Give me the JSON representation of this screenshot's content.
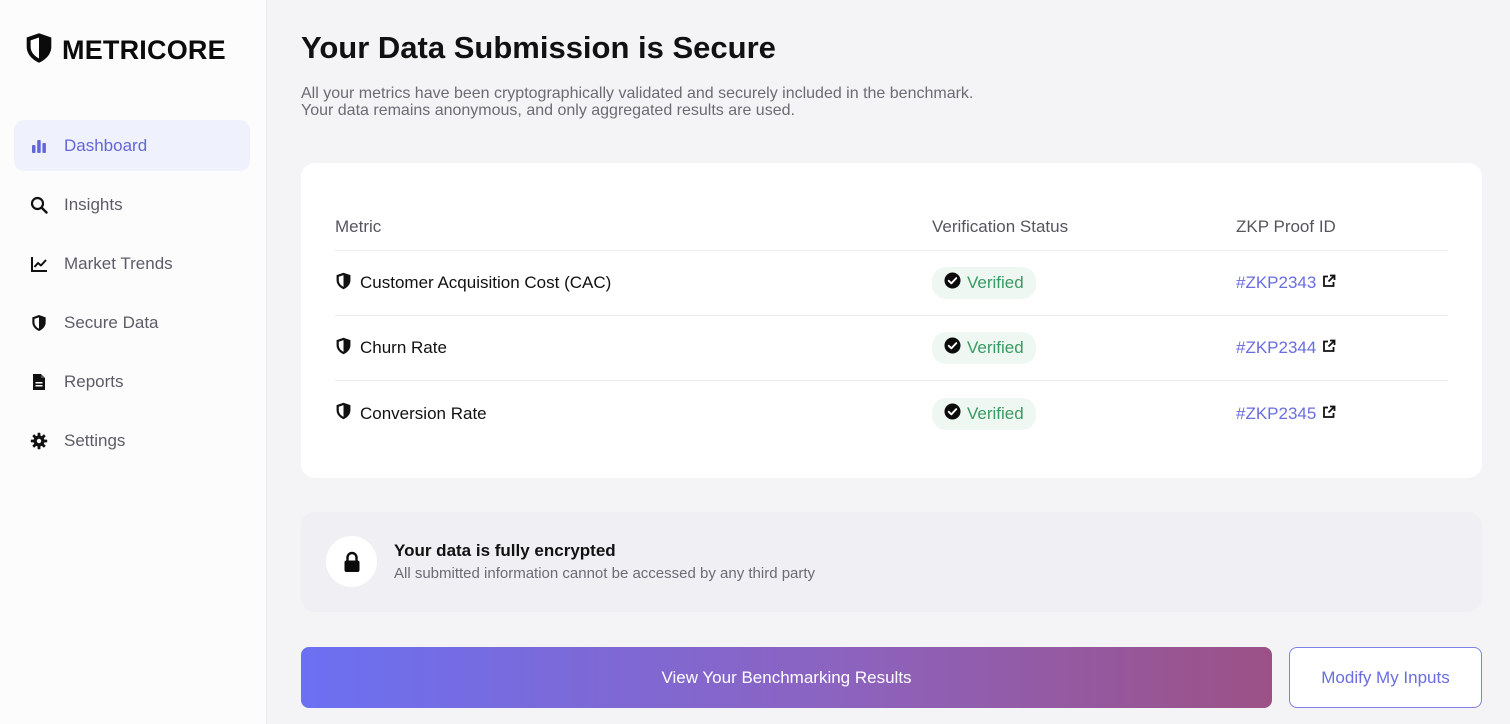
{
  "app": {
    "name": "METRICORE",
    "logo_icon": "shield-icon"
  },
  "sidebar": {
    "items": [
      {
        "label": "Dashboard",
        "icon": "bar-chart-icon",
        "active": true
      },
      {
        "label": "Insights",
        "icon": "search-icon",
        "active": false
      },
      {
        "label": "Market Trends",
        "icon": "line-chart-icon",
        "active": false
      },
      {
        "label": "Secure Data",
        "icon": "shield-icon",
        "active": false
      },
      {
        "label": "Reports",
        "icon": "document-icon",
        "active": false
      },
      {
        "label": "Settings",
        "icon": "gear-icon",
        "active": false
      }
    ]
  },
  "main": {
    "title": "Your Data Submission is Secure",
    "subtitle_line1": "All your metrics have been cryptographically validated and securely included in the benchmark.",
    "subtitle_line2": "Your data remains anonymous, and only aggregated results are used."
  },
  "table": {
    "headers": [
      "Metric",
      "Verification Status",
      "ZKP Proof ID"
    ],
    "rows": [
      {
        "metric": "Customer Acquisition Cost (CAC)",
        "status": "Verified",
        "proof_id": "#ZKP2343"
      },
      {
        "metric": "Churn Rate",
        "status": "Verified",
        "proof_id": "#ZKP2344"
      },
      {
        "metric": "Conversion Rate",
        "status": "Verified",
        "proof_id": "#ZKP2345"
      }
    ]
  },
  "encryption": {
    "title": "Your data is fully encrypted",
    "subtitle": "All submitted information cannot be accessed by any third party",
    "icon": "lock-icon"
  },
  "actions": {
    "primary_label": "View Your Benchmarking Results",
    "secondary_label": "Modify My Inputs"
  },
  "colors": {
    "accent": "#6366d6",
    "verified": "#3a9a63",
    "link": "#6a6de0"
  }
}
